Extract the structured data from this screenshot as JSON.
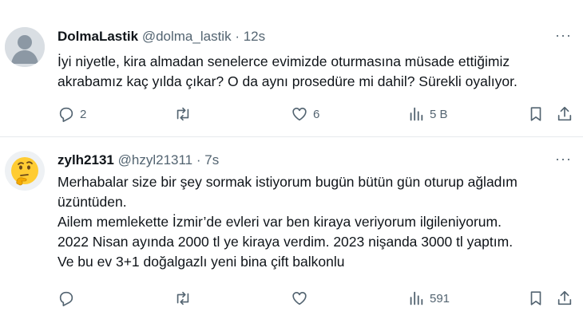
{
  "tweets": [
    {
      "name": "DolmaLastik",
      "handle": "@dolma_lastik",
      "dot": "·",
      "time": "12s",
      "lines": [
        "İyi niyetle, kira almadan senelerce evimizde oturmasına müsade ettiğimiz",
        "akrabamız kaç yılda çıkar? O da aynı prosedüre mi dahil? Sürekli oyalıyor."
      ],
      "replies": "2",
      "retweets": "",
      "likes": "6",
      "views": "5 B",
      "avatar": "default-avatar"
    },
    {
      "name": "zylh2131",
      "handle": "@hzyl21311",
      "dot": "·",
      "time": "7s",
      "lines": [
        "Merhabalar size bir şey sormak istiyorum bugün bütün gün oturup ağladım",
        "üzüntüden.",
        "Ailem memlekette İzmir’de evleri var ben kiraya veriyorum ilgileniyorum.",
        "2022 Nisan ayında 2000 tl ye kiraya verdim. 2023 nişanda 3000 tl yaptım.",
        "Ve bu ev 3+1 doğalgazlı yeni bina çift balkonlu"
      ],
      "replies": "",
      "retweets": "",
      "likes": "",
      "views": "591",
      "avatar": "thinking-face-emoji"
    }
  ],
  "more_label": "···",
  "colors": {
    "text": "#0f1419",
    "muted": "#536471",
    "divider": "#e6e9ec",
    "emoji": "#ffcc33"
  }
}
